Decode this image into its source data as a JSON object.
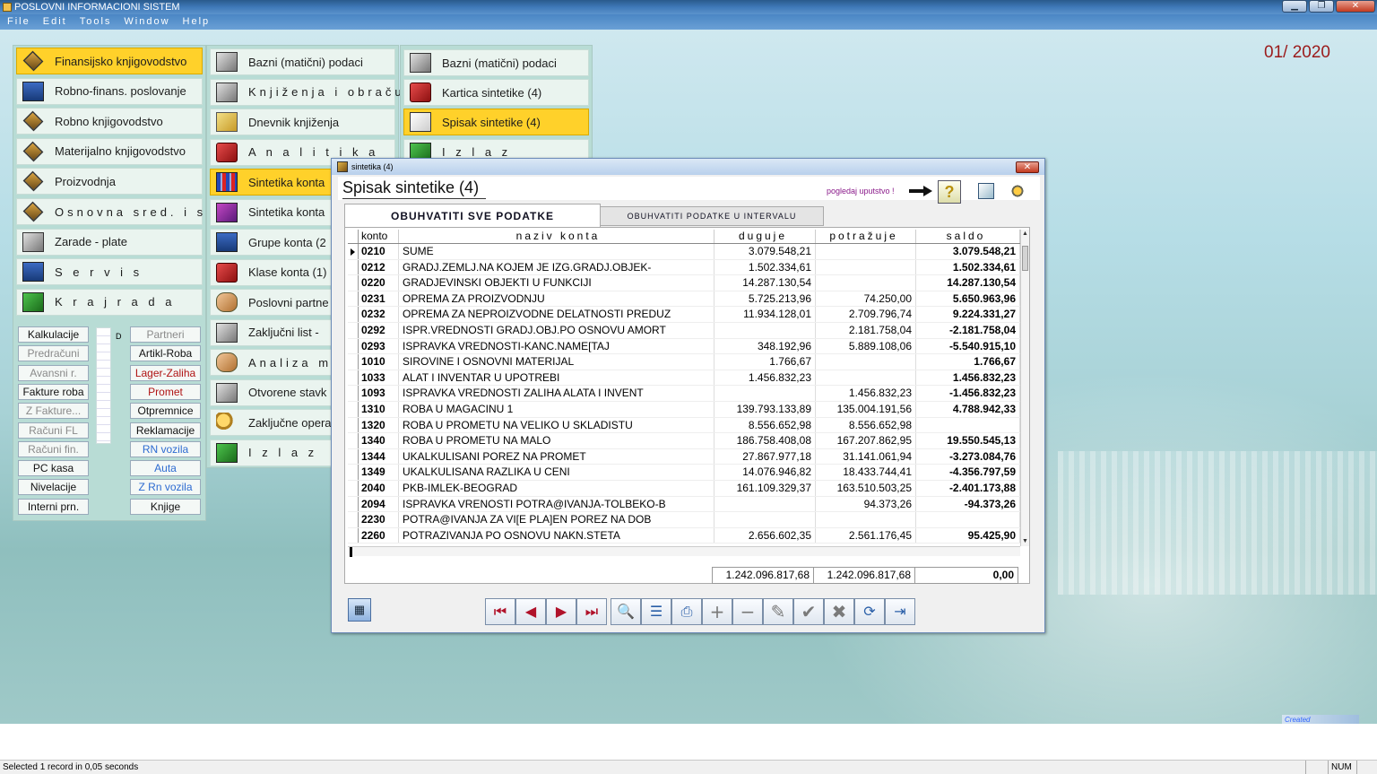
{
  "window": {
    "title": "POSLOVNI INFORMACIONI SISTEM",
    "controls": [
      "▁",
      "❐",
      "✕"
    ]
  },
  "menubar": [
    "File",
    "Edit",
    "Tools",
    "Window",
    "Help"
  ],
  "period": "01/ 2020",
  "main_menu": [
    {
      "label": "Finansijsko knjigovodstvo",
      "icon": "ledger-diamond-icon",
      "selected": true
    },
    {
      "label": "Robno-finans. poslovanje",
      "icon": "truck-icon"
    },
    {
      "label": "Robno knjigovodstvo",
      "icon": "ledger-diamond-icon"
    },
    {
      "label": "Materijalno knjigovodstvo",
      "icon": "ledger-diamond-icon"
    },
    {
      "label": "Proizvodnja",
      "icon": "ledger-diamond-icon"
    },
    {
      "label": "Osnovna sred. i sitan inv.",
      "icon": "ledger-diamond-icon"
    },
    {
      "label": "Zarade - plate",
      "icon": "wages-icon"
    },
    {
      "label": "S e r v i s",
      "icon": "computer-icon"
    },
    {
      "label": "K r a j   r a d a",
      "icon": "exit-door-icon"
    }
  ],
  "sub_buttons": {
    "left": [
      {
        "label": "Kalkulacije",
        "style": ""
      },
      {
        "label": "Predračuni",
        "style": "dis"
      },
      {
        "label": "Avansni r.",
        "style": "dis"
      },
      {
        "label": "Fakture roba",
        "style": ""
      },
      {
        "label": "Z Fakture...",
        "style": "dis"
      },
      {
        "label": "Računi FL",
        "style": "dis"
      },
      {
        "label": "Računi fin.",
        "style": "dis"
      },
      {
        "label": "PC kasa",
        "style": ""
      },
      {
        "label": "Nivelacije",
        "style": ""
      },
      {
        "label": "Interni prn.",
        "style": ""
      }
    ],
    "right": [
      {
        "label": "Partneri",
        "style": "dis"
      },
      {
        "label": "Artikl-Roba",
        "style": ""
      },
      {
        "label": "Lager-Zaliha",
        "style": "red"
      },
      {
        "label": "Promet",
        "style": "red"
      },
      {
        "label": "Otpremnice",
        "style": ""
      },
      {
        "label": "Reklamacije",
        "style": ""
      },
      {
        "label": "RN vozila",
        "style": "blue"
      },
      {
        "label": "Auta",
        "style": "blue"
      },
      {
        "label": "Z Rn vozila",
        "style": "blue"
      },
      {
        "label": "Knjige",
        "style": ""
      }
    ],
    "marker": "D"
  },
  "second_menu": [
    {
      "label": "Bazni (matični) podaci",
      "icon": "database-icon"
    },
    {
      "label": "Knjiženja i obračun PDVa",
      "icon": "posting-icon"
    },
    {
      "label": "Dnevnik knjiženja",
      "icon": "journal-icon"
    },
    {
      "label": "A n a l i t i k a",
      "icon": "analytics-book-icon"
    },
    {
      "label": "Sintetika konta",
      "icon": "bar-chart-icon",
      "selected": true
    },
    {
      "label": "Sintetika konta",
      "icon": "books-stack-icon"
    },
    {
      "label": "Grupe konta (2",
      "icon": "group-books-icon"
    },
    {
      "label": "Klase konta (1)",
      "icon": "class-book-icon"
    },
    {
      "label": "Poslovni partne",
      "icon": "handshake-icon"
    },
    {
      "label": "Zaključni list - ",
      "icon": "document-icon"
    },
    {
      "label": "Analiza mtr i ka",
      "icon": "analysis-icon"
    },
    {
      "label": "Otvorene stavk",
      "icon": "open-book-icon"
    },
    {
      "label": "Zaključne opera",
      "icon": "keys-icon"
    },
    {
      "label": "I z l a z",
      "icon": "exit-door-icon"
    }
  ],
  "third_menu": [
    {
      "label": "Bazni (matični) podaci",
      "icon": "database-icon"
    },
    {
      "label": "Kartica sintetike (4)",
      "icon": "card-icon"
    },
    {
      "label": "Spisak sintetike (4)",
      "icon": "list-icon",
      "selected": true
    },
    {
      "label": "I z l a z",
      "icon": "exit-door-icon"
    }
  ],
  "dialog": {
    "title": "sintetika (4)",
    "heading": "Spisak sintetike (4)",
    "help_link": "pogledaj uputstvo !",
    "help_symbol": "?",
    "close": "✕",
    "tab_active": "OBUHVATITI  SVE  PODATKE",
    "tab_inactive": "OBUHVATITI  PODATKE  U  INTERVALU",
    "columns": {
      "konto": "konto",
      "naziv": "naziv  konta",
      "duguje": "duguje",
      "potrazuje": "potražuje",
      "saldo": "saldo"
    },
    "rows": [
      [
        "0210",
        "SUME",
        "3.079.548,21",
        "",
        "3.079.548,21"
      ],
      [
        "0212",
        "GRADJ.ZEMLJ.NA KOJEM JE IZG.GRADJ.OBJEK-",
        "1.502.334,61",
        "",
        "1.502.334,61"
      ],
      [
        "0220",
        "GRADJEVINSKI OBJEKTI U FUNKCIJI",
        "14.287.130,54",
        "",
        "14.287.130,54"
      ],
      [
        "0231",
        "OPREMA ZA PROIZVODNJU",
        "5.725.213,96",
        "74.250,00",
        "5.650.963,96"
      ],
      [
        "0232",
        "OPREMA ZA NEPROIZVODNE DELATNOSTI PREDUZ",
        "11.934.128,01",
        "2.709.796,74",
        "9.224.331,27"
      ],
      [
        "0292",
        "ISPR.VREDNOSTI GRADJ.OBJ.PO OSNOVU AMORT",
        "",
        "2.181.758,04",
        "-2.181.758,04"
      ],
      [
        "0293",
        "ISPRAVKA VREDNOSTI-KANC.NAME[TAJ",
        "348.192,96",
        "5.889.108,06",
        "-5.540.915,10"
      ],
      [
        "1010",
        "SIROVINE I OSNOVNI MATERIJAL",
        "1.766,67",
        "",
        "1.766,67"
      ],
      [
        "1033",
        "ALAT I INVENTAR U UPOTREBI",
        "1.456.832,23",
        "",
        "1.456.832,23"
      ],
      [
        "1093",
        "ISPRAVKA VREDNOSTI ZALIHA ALATA I INVENT",
        "",
        "1.456.832,23",
        "-1.456.832,23"
      ],
      [
        "1310",
        "ROBA U MAGACINU 1",
        "139.793.133,89",
        "135.004.191,56",
        "4.788.942,33"
      ],
      [
        "1320",
        "ROBA U PROMETU NA VELIKO U SKLADISTU",
        "8.556.652,98",
        "8.556.652,98",
        ""
      ],
      [
        "1340",
        "ROBA U PROMETU NA MALO",
        "186.758.408,08",
        "167.207.862,95",
        "19.550.545,13"
      ],
      [
        "1344",
        "UKALKULISANI POREZ NA PROMET",
        "27.867.977,18",
        "31.141.061,94",
        "-3.273.084,76"
      ],
      [
        "1349",
        "UKALKULISANA RAZLIKA U CENI",
        "14.076.946,82",
        "18.433.744,41",
        "-4.356.797,59"
      ],
      [
        "2040",
        "PKB-IMLEK-BEOGRAD",
        "161.109.329,37",
        "163.510.503,25",
        "-2.401.173,88"
      ],
      [
        "2094",
        "ISPRAVKA VRENOSTI POTRA@IVANJA-TOLBEKO-B",
        "",
        "94.373,26",
        "-94.373,26"
      ],
      [
        "2230",
        "POTRA@IVANJA ZA VI[E PLA]EN POREZ NA DOB",
        "",
        "",
        ""
      ],
      [
        "2260",
        "POTRAZIVANJA PO OSNOVU NAKN.STETA",
        "2.656.602,35",
        "2.561.176,45",
        "95.425,90"
      ]
    ],
    "totals": {
      "duguje": "1.242.096.817,68",
      "potrazuje": "1.242.096.817,68",
      "saldo": "0,00"
    },
    "toolbar": [
      {
        "name": "first-record-button",
        "glyph": "⏮",
        "cls": ""
      },
      {
        "name": "prev-record-button",
        "glyph": "◀",
        "cls": ""
      },
      {
        "name": "next-record-button",
        "glyph": "▶",
        "cls": ""
      },
      {
        "name": "last-record-button",
        "glyph": "⏭",
        "cls": ""
      },
      {
        "name": "search-button",
        "glyph": "🔍",
        "cls": "blue"
      },
      {
        "name": "form-view-button",
        "glyph": "☰",
        "cls": "blue"
      },
      {
        "name": "print-button",
        "glyph": "⎙",
        "cls": "blue"
      },
      {
        "name": "add-record-button",
        "glyph": "+",
        "cls": "gray"
      },
      {
        "name": "delete-record-button",
        "glyph": "−",
        "cls": "gray"
      },
      {
        "name": "edit-record-button",
        "glyph": "✎",
        "cls": "gray"
      },
      {
        "name": "save-button",
        "glyph": "✔",
        "cls": "gray"
      },
      {
        "name": "cancel-button",
        "glyph": "✖",
        "cls": "gray"
      },
      {
        "name": "refresh-button",
        "glyph": "⟳",
        "cls": "blue"
      },
      {
        "name": "exit-button",
        "glyph": "⇥",
        "cls": "blue"
      }
    ],
    "calc_glyph": "▦"
  },
  "created_badge": "Created",
  "status": {
    "message": "Selected 1 record in 0,05 seconds",
    "num": "NUM"
  }
}
